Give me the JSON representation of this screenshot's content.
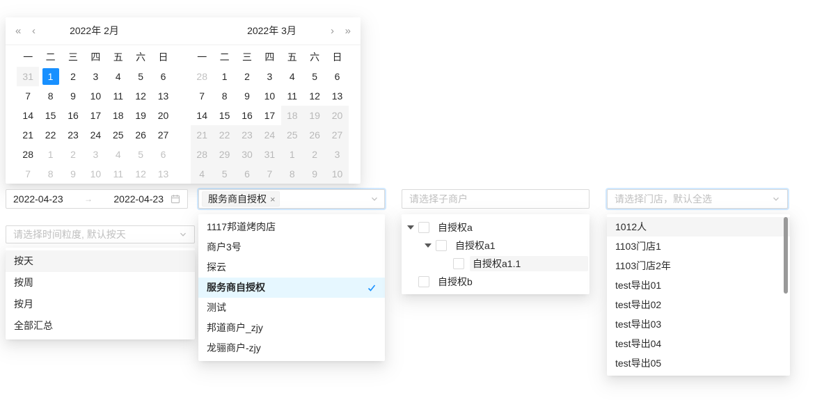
{
  "calendar": {
    "nav": {
      "prev_year": "«",
      "prev_month": "‹",
      "next_month": "›",
      "next_year": "»"
    },
    "weekdays": [
      "一",
      "二",
      "三",
      "四",
      "五",
      "六",
      "日"
    ],
    "months": [
      {
        "title": "2022年 2月",
        "rows": [
          [
            [
              "31",
              "d"
            ],
            [
              "1",
              "s"
            ],
            [
              "2",
              "n"
            ],
            [
              "3",
              "n"
            ],
            [
              "4",
              "n"
            ],
            [
              "5",
              "n"
            ],
            [
              "6",
              "n"
            ]
          ],
          [
            [
              "7",
              "n"
            ],
            [
              "8",
              "n"
            ],
            [
              "9",
              "n"
            ],
            [
              "10",
              "n"
            ],
            [
              "11",
              "n"
            ],
            [
              "12",
              "n"
            ],
            [
              "13",
              "n"
            ]
          ],
          [
            [
              "14",
              "n"
            ],
            [
              "15",
              "n"
            ],
            [
              "16",
              "n"
            ],
            [
              "17",
              "n"
            ],
            [
              "18",
              "n"
            ],
            [
              "19",
              "n"
            ],
            [
              "20",
              "n"
            ]
          ],
          [
            [
              "21",
              "n"
            ],
            [
              "22",
              "n"
            ],
            [
              "23",
              "n"
            ],
            [
              "24",
              "n"
            ],
            [
              "25",
              "n"
            ],
            [
              "26",
              "n"
            ],
            [
              "27",
              "n"
            ]
          ],
          [
            [
              "28",
              "n"
            ],
            [
              "1",
              "m"
            ],
            [
              "2",
              "m"
            ],
            [
              "3",
              "m"
            ],
            [
              "4",
              "m"
            ],
            [
              "5",
              "m"
            ],
            [
              "6",
              "m"
            ]
          ],
          [
            [
              "7",
              "m"
            ],
            [
              "8",
              "m"
            ],
            [
              "9",
              "m"
            ],
            [
              "10",
              "m"
            ],
            [
              "11",
              "m"
            ],
            [
              "12",
              "m"
            ],
            [
              "13",
              "m"
            ]
          ]
        ]
      },
      {
        "title": "2022年 3月",
        "rows": [
          [
            [
              "28",
              "m"
            ],
            [
              "1",
              "n"
            ],
            [
              "2",
              "n"
            ],
            [
              "3",
              "n"
            ],
            [
              "4",
              "n"
            ],
            [
              "5",
              "n"
            ],
            [
              "6",
              "n"
            ]
          ],
          [
            [
              "7",
              "n"
            ],
            [
              "8",
              "n"
            ],
            [
              "9",
              "n"
            ],
            [
              "10",
              "n"
            ],
            [
              "11",
              "n"
            ],
            [
              "12",
              "n"
            ],
            [
              "13",
              "n"
            ]
          ],
          [
            [
              "14",
              "n"
            ],
            [
              "15",
              "n"
            ],
            [
              "16",
              "n"
            ],
            [
              "17",
              "n"
            ],
            [
              "18",
              "d"
            ],
            [
              "19",
              "d"
            ],
            [
              "20",
              "d"
            ]
          ],
          [
            [
              "21",
              "d"
            ],
            [
              "22",
              "d"
            ],
            [
              "23",
              "d"
            ],
            [
              "24",
              "d"
            ],
            [
              "25",
              "d"
            ],
            [
              "26",
              "d"
            ],
            [
              "27",
              "d"
            ]
          ],
          [
            [
              "28",
              "d"
            ],
            [
              "29",
              "d"
            ],
            [
              "30",
              "d"
            ],
            [
              "31",
              "d"
            ],
            [
              "1",
              "d"
            ],
            [
              "2",
              "d"
            ],
            [
              "3",
              "d"
            ]
          ],
          [
            [
              "4",
              "d"
            ],
            [
              "5",
              "d"
            ],
            [
              "6",
              "d"
            ],
            [
              "7",
              "d"
            ],
            [
              "8",
              "d"
            ],
            [
              "9",
              "d"
            ],
            [
              "10",
              "d"
            ]
          ]
        ]
      }
    ]
  },
  "date_range": {
    "start": "2022-04-23",
    "separator": "→",
    "end": "2022-04-23"
  },
  "granularity": {
    "placeholder": "请选择时间粒度, 默认按天",
    "options": [
      {
        "label": "按天",
        "active": true
      },
      {
        "label": "按周"
      },
      {
        "label": "按月"
      },
      {
        "label": "全部汇总"
      }
    ]
  },
  "merchant": {
    "tag_label": "服务商自授权",
    "tag_close": "×",
    "options": [
      {
        "label": "1117邦道烤肉店"
      },
      {
        "label": "商户3号"
      },
      {
        "label": "探云"
      },
      {
        "label": "服务商自授权",
        "selected": true
      },
      {
        "label": "测试"
      },
      {
        "label": "邦道商户_zjy"
      },
      {
        "label": "龙骊商户-zjy"
      }
    ]
  },
  "sub_merchant": {
    "placeholder": "请选择子商户",
    "tree": [
      {
        "label": "自授权a",
        "level": 0,
        "caret": true
      },
      {
        "label": "自授权a1",
        "level": 1,
        "caret": true
      },
      {
        "label": "自授权a1.1",
        "level": 2,
        "caret": false,
        "highlight": true
      },
      {
        "label": "自授权b",
        "level": 0,
        "caret": false
      }
    ]
  },
  "store": {
    "placeholder": "请选择门店，默认全选",
    "options": [
      {
        "label": "1012人",
        "active": true
      },
      {
        "label": "1103门店1"
      },
      {
        "label": "1103门店2年"
      },
      {
        "label": "test导出01"
      },
      {
        "label": "test导出02"
      },
      {
        "label": "test导出03"
      },
      {
        "label": "test导出04"
      },
      {
        "label": "test导出05"
      }
    ]
  },
  "colors": {
    "primary": "#1890ff",
    "selected_option_bg": "#e6f7ff",
    "active_option_bg": "#f5f5f5",
    "disabled_cell_bg": "#f5f5f5",
    "border": "#d9d9d9",
    "placeholder_text": "#bfbfbf"
  }
}
